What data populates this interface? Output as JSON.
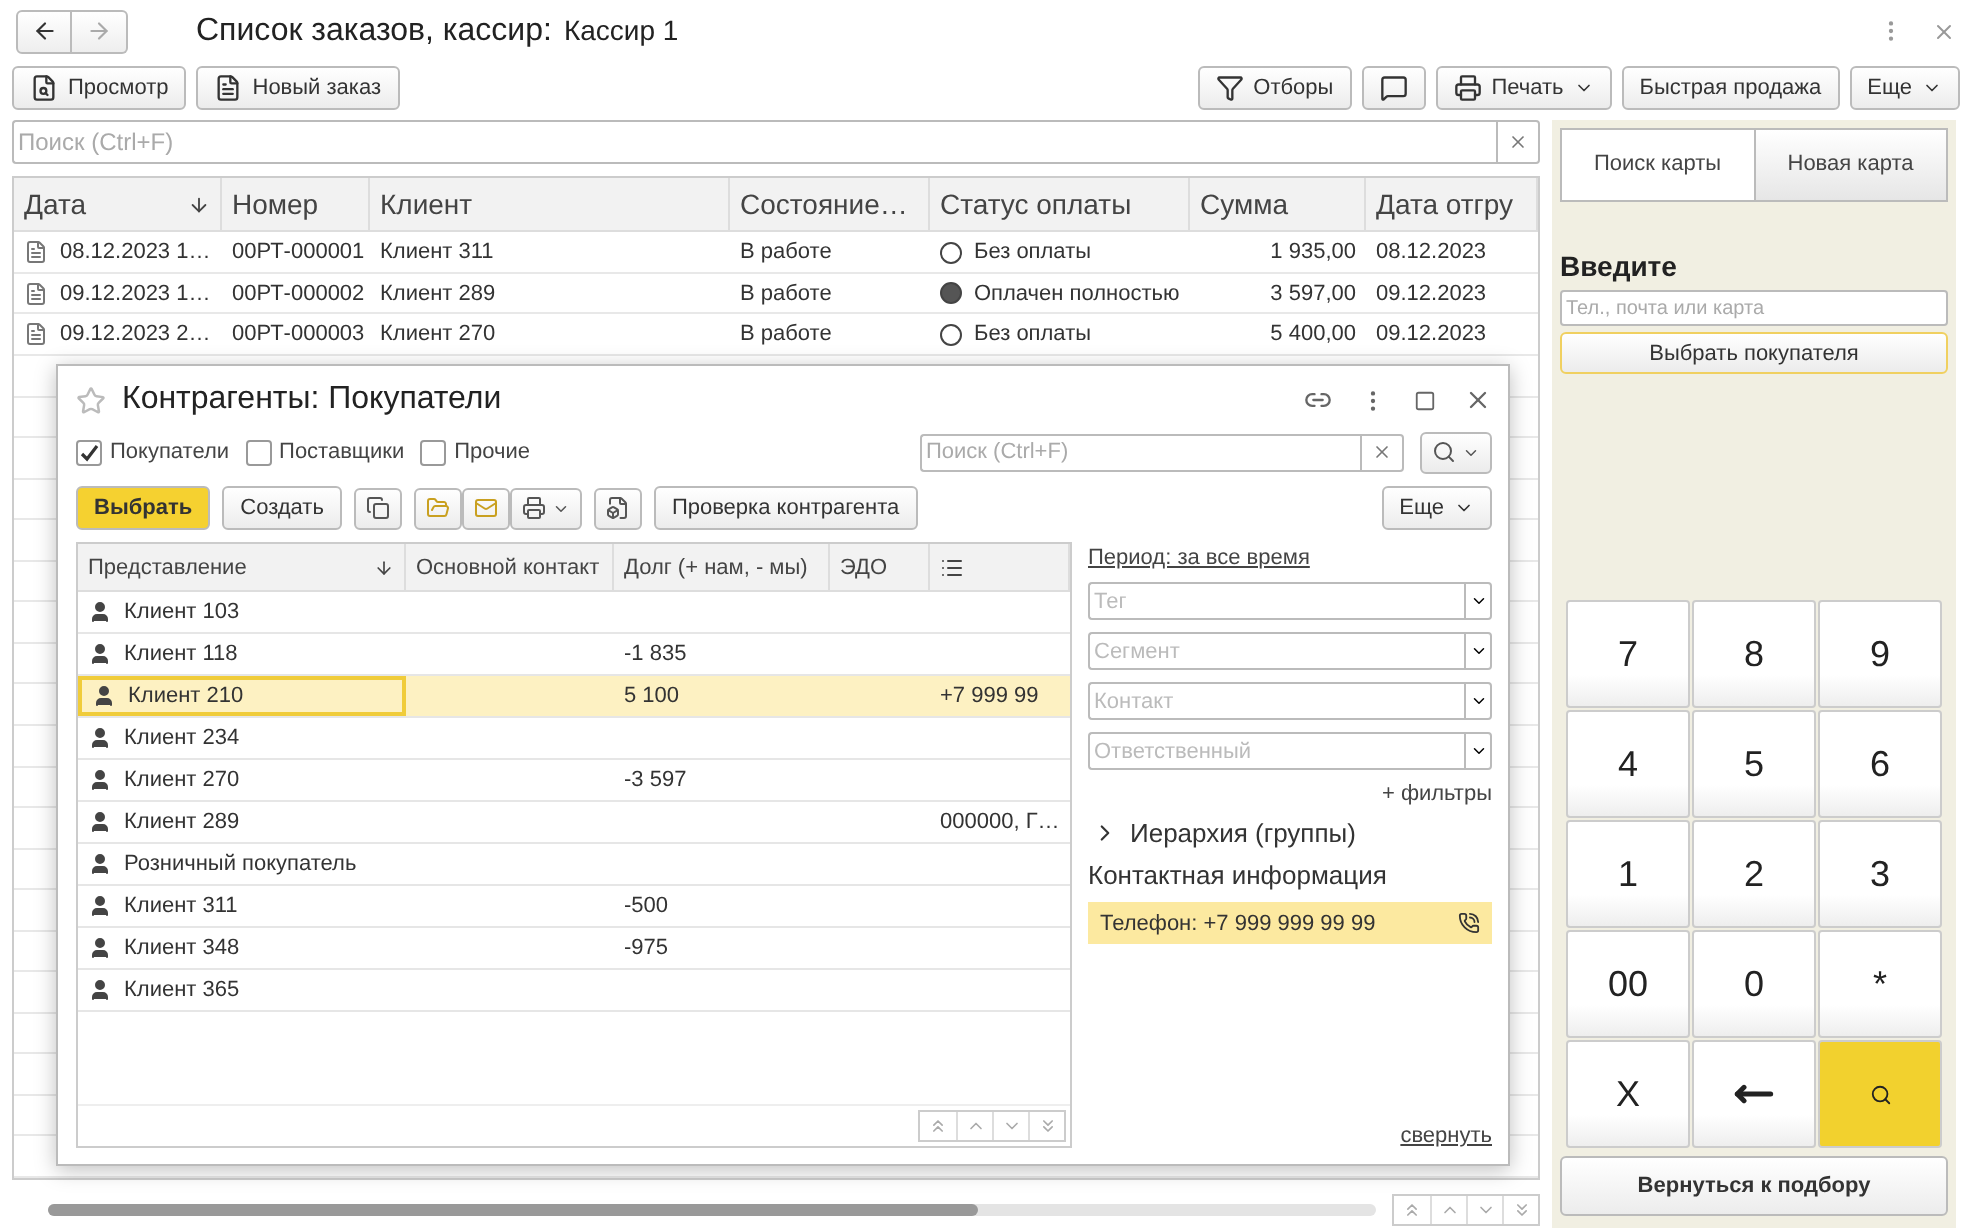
{
  "window": {
    "title": "Список заказов, кассир:",
    "cashier": "Кассир 1"
  },
  "toolbar": {
    "left": [
      {
        "label": "Просмотр"
      },
      {
        "label": "Новый заказ"
      }
    ],
    "right": [
      {
        "kind": "button",
        "label": "Отборы"
      },
      {
        "kind": "icon"
      },
      {
        "kind": "menu",
        "label": "Печать"
      },
      {
        "kind": "button",
        "label": "Быстрая продажа"
      },
      {
        "kind": "menu",
        "label": "Еще"
      }
    ]
  },
  "search": {
    "placeholder": "Поиск (Ctrl+F)"
  },
  "orders": {
    "columns": [
      {
        "label": "Дата",
        "sorted": true
      },
      {
        "label": "Номер",
        "sorted": false
      },
      {
        "label": "Клиент",
        "sorted": false
      },
      {
        "label": "Состояние…",
        "sorted": false
      },
      {
        "label": "Статус оплаты",
        "sorted": false
      },
      {
        "label": "Сумма",
        "sorted": false
      },
      {
        "label": "Дата отгру",
        "sorted": false
      }
    ],
    "rows": [
      {
        "date": "08.12.2023 1…",
        "number": "00РТ-000001",
        "client": "Клиент 311",
        "state": "В работе",
        "payment": "Без оплаты",
        "paid": false,
        "sum": "1 935,00",
        "ship_date": "08.12.2023"
      },
      {
        "date": "09.12.2023 1…",
        "number": "00РТ-000002",
        "client": "Клиент 289",
        "state": "В работе",
        "payment": "Оплачен полностью",
        "paid": true,
        "sum": "3 597,00",
        "ship_date": "09.12.2023"
      },
      {
        "date": "09.12.2023 2…",
        "number": "00РТ-000003",
        "client": "Клиент 270",
        "state": "В работе",
        "payment": "Без оплаты",
        "paid": false,
        "sum": "5 400,00",
        "ship_date": "09.12.2023"
      }
    ]
  },
  "side_panel": {
    "tabs": [
      {
        "label": "Поиск карты",
        "selected": true
      },
      {
        "label": "Новая карта",
        "selected": false
      }
    ],
    "prompt": "Введите",
    "input": {
      "placeholder": "Тел., почта или карта"
    },
    "choose_button": "Выбрать покупателя",
    "keypad": [
      {
        "kind": "text",
        "label": "7"
      },
      {
        "kind": "text",
        "label": "8"
      },
      {
        "kind": "text",
        "label": "9"
      },
      {
        "kind": "text",
        "label": "4"
      },
      {
        "kind": "text",
        "label": "5"
      },
      {
        "kind": "text",
        "label": "6"
      },
      {
        "kind": "text",
        "label": "1"
      },
      {
        "kind": "text",
        "label": "2"
      },
      {
        "kind": "text",
        "label": "3"
      },
      {
        "kind": "text",
        "label": "00"
      },
      {
        "kind": "text",
        "label": "0"
      },
      {
        "kind": "text",
        "label": "*"
      },
      {
        "kind": "text",
        "label": "X"
      },
      {
        "kind": "backspace"
      },
      {
        "kind": "search"
      }
    ],
    "back_button": "Вернуться к подбору"
  },
  "dialog": {
    "title": "Контрагенты: Покупатели",
    "favorite": false,
    "filters": [
      {
        "label": "Покупатели",
        "checked": true
      },
      {
        "label": "Поставщики",
        "checked": false
      },
      {
        "label": "Прочие",
        "checked": false
      }
    ],
    "search": {
      "placeholder": "Поиск (Ctrl+F)"
    },
    "select_button": "Выбрать",
    "create_button": "Создать",
    "check_button": "Проверка контрагента",
    "more_button": "Еще",
    "columns": [
      {
        "label": "Представление",
        "sorted": true
      },
      {
        "label": "Основной контакт",
        "sorted": false
      },
      {
        "label": "Долг (+ нам, - мы)",
        "sorted": false
      },
      {
        "label": "ЭДО",
        "sorted": false
      }
    ],
    "rows": [
      {
        "name": "Клиент 103",
        "selected": false
      },
      {
        "name": "Клиент 118",
        "debt": "-1 835",
        "selected": false
      },
      {
        "name": "Клиент 210",
        "debt": "5 100",
        "extra": "+7 999 99",
        "selected": true
      },
      {
        "name": "Клиент 234",
        "selected": false
      },
      {
        "name": "Клиент 270",
        "debt": "-3 597",
        "selected": false
      },
      {
        "name": "Клиент 289",
        "extra": "000000, Г…",
        "selected": false
      },
      {
        "name": "Розничный покупатель",
        "selected": false
      },
      {
        "name": "Клиент 311",
        "debt": "-500",
        "selected": false
      },
      {
        "name": "Клиент 348",
        "debt": "-975",
        "selected": false
      },
      {
        "name": "Клиент 365",
        "selected": false
      }
    ],
    "period_link": "Период: за все время",
    "selects": [
      {
        "placeholder": "Тег"
      },
      {
        "placeholder": "Сегмент"
      },
      {
        "placeholder": "Контакт"
      },
      {
        "placeholder": "Ответственный"
      }
    ],
    "more_filters": "+ фильтры",
    "hierarchy": {
      "label": "Иерархия (группы)",
      "expanded": false
    },
    "contact_heading": "Контактная информация",
    "phone": "Телефон: +7 999 999 99 99",
    "collapse_link": "свернуть"
  }
}
